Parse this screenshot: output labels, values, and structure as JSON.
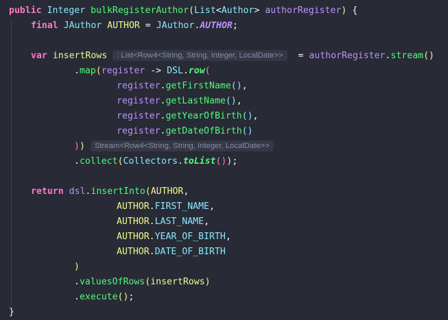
{
  "editor": {
    "hints": {
      "insert_rows_type": ": List<Row4<String, String, Integer, LocalDate>>",
      "map_result_type": "Stream<Row4<String, String, Integer, LocalDate>>"
    },
    "code": {
      "kw_public": "public",
      "kw_final": "final",
      "kw_var": "var",
      "kw_return": "return",
      "type_integer": "Integer",
      "type_list": "List",
      "type_author": "Author",
      "type_jauthor": "JAuthor",
      "type_dsl": "DSL",
      "type_collectors": "Collectors",
      "method_name": "bulkRegisterAuthor",
      "param_name": "authorRegister",
      "const_author": "AUTHOR",
      "field_AUTHOR": "AUTHOR",
      "var_insert_rows": "insertRows",
      "lambda_param": "register",
      "m_stream": "stream",
      "m_map": "map",
      "m_row": "row",
      "m_get_first_name": "getFirstName",
      "m_get_last_name": "getLastName",
      "m_get_year_of_birth": "getYearOfBirth",
      "m_get_date_of_birth": "getDateOfBirth",
      "m_collect": "collect",
      "m_to_list": "toList",
      "dsl_var": "dsl",
      "m_insert_into": "insertInto",
      "f_first_name": "FIRST_NAME",
      "f_last_name": "LAST_NAME",
      "f_year_of_birth": "YEAR_OF_BIRTH",
      "f_date_of_birth": "DATE_OF_BIRTH",
      "m_values_of_rows": "valuesOfRows",
      "m_execute": "execute",
      "arrow": "->"
    }
  }
}
